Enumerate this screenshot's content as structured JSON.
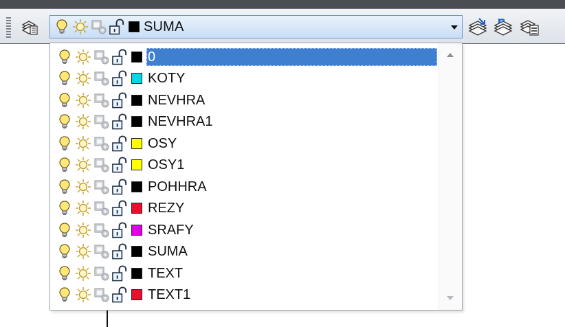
{
  "toolbar": {
    "current_layer": "SUMA",
    "current_color": "#000000",
    "left_button_icon": "layer-properties-icon",
    "right_buttons": [
      "make-current-icon",
      "layer-previous-icon",
      "layer-states-icon"
    ]
  },
  "layers": [
    {
      "name": "0",
      "color": "#000000",
      "selected": true
    },
    {
      "name": "KOTY",
      "color": "#00d8e8"
    },
    {
      "name": "NEVHRA",
      "color": "#000000"
    },
    {
      "name": "NEVHRA1",
      "color": "#000000"
    },
    {
      "name": "OSY",
      "color": "#ffff00"
    },
    {
      "name": "OSY1",
      "color": "#ffff00"
    },
    {
      "name": "POHHRA",
      "color": "#000000"
    },
    {
      "name": "REZY",
      "color": "#e8102a"
    },
    {
      "name": "SRAFY",
      "color": "#e000e8"
    },
    {
      "name": "SUMA",
      "color": "#000000"
    },
    {
      "name": "TEXT",
      "color": "#000000"
    },
    {
      "name": "TEXT1",
      "color": "#e8102a"
    }
  ],
  "row_icons": [
    "bulb-on-icon",
    "sun-thaw-icon",
    "viewport-freeze-icon",
    "unlock-icon"
  ],
  "selection_color": "#3f7fd0"
}
